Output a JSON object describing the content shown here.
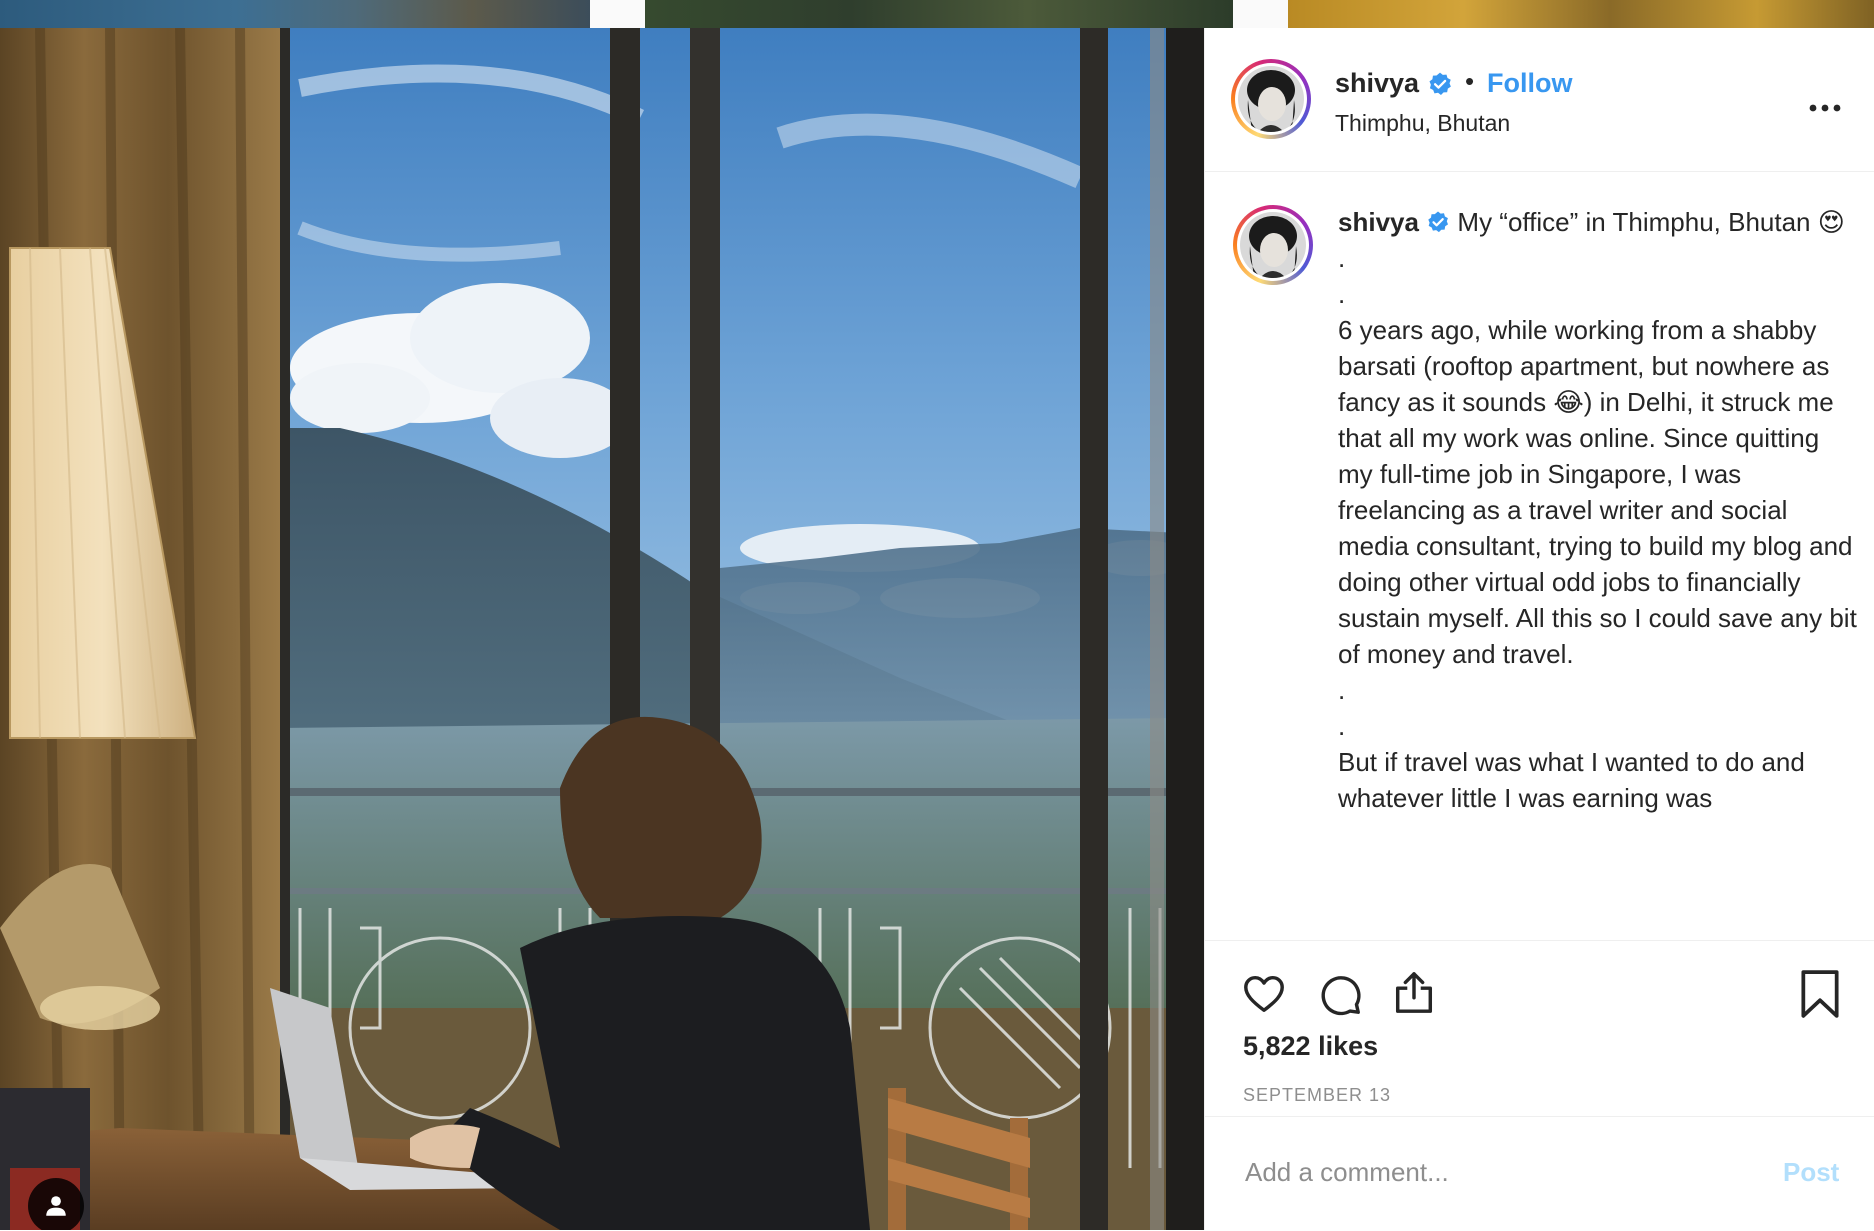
{
  "post": {
    "username": "shivya",
    "follow_label": "Follow",
    "separator": "•",
    "location": "Thimphu, Bhutan",
    "caption": " My “office” in Thimphu, Bhutan 😍\n.\n.\n6 years ago, while working from a shabby barsati (rooftop apartment, but nowhere as fancy as it sounds 😂) in Delhi, it struck me that all my work was online. Since quitting my full-time job in Singapore, I was freelancing as a travel writer and social media consultant, trying to build my blog and doing other virtual odd jobs to financially sustain myself. All this so I could save any bit of money and travel.\n.\n.\nBut if travel was what I wanted to do and whatever little I was earning was",
    "likes": "5,822 likes",
    "date": "SEPTEMBER 13"
  },
  "comment": {
    "placeholder": "Add a comment...",
    "post_label": "Post"
  },
  "icons": {
    "verified": "verified-badge-icon",
    "more": "more-options-icon",
    "like": "heart-icon",
    "comment": "comment-bubble-icon",
    "share": "share-icon",
    "save": "bookmark-icon",
    "tag": "user-tag-icon"
  },
  "colors": {
    "link_blue": "#3897f0",
    "verified_blue": "#3897f0",
    "post_disabled": "#b2dffc",
    "meta_gray": "#8e8e8e"
  }
}
